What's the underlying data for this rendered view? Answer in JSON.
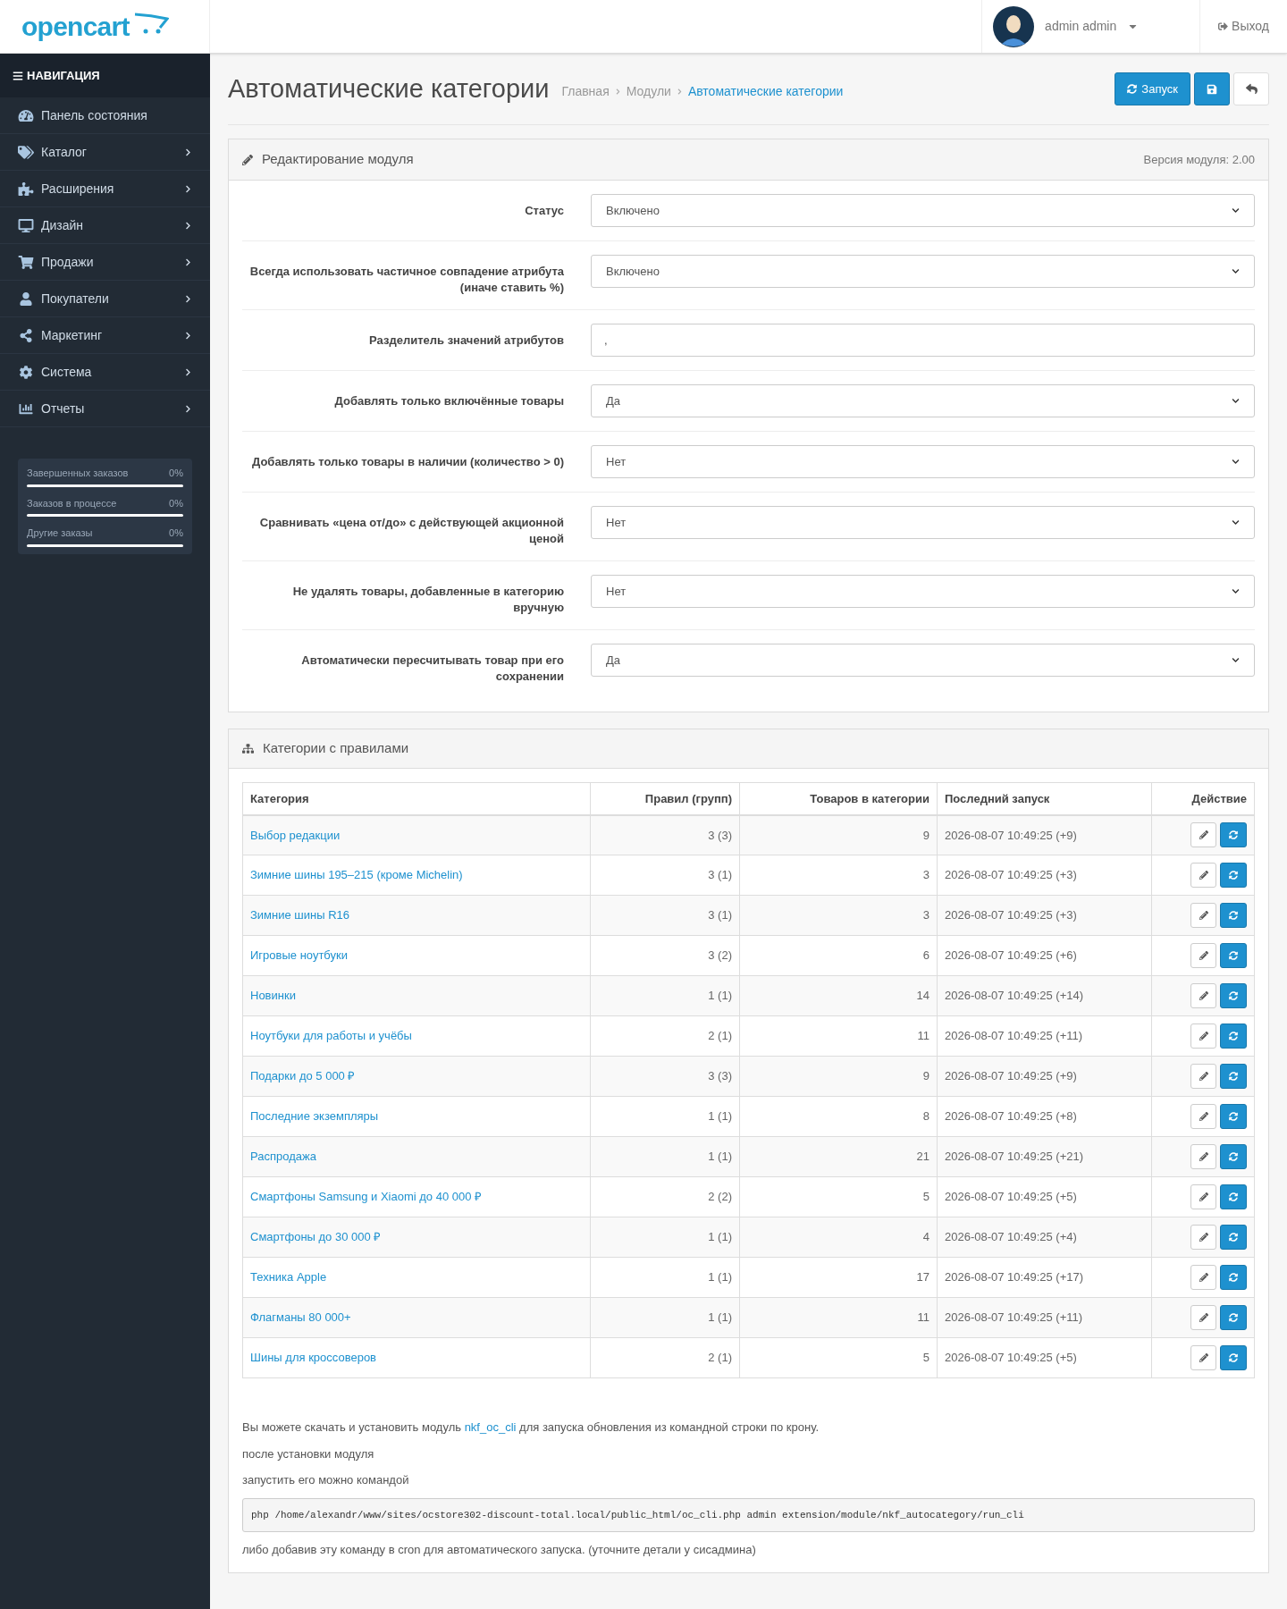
{
  "header": {
    "logo": "opencart",
    "user": "admin admin",
    "logout": "Выход"
  },
  "sidebar": {
    "title": "НАВИГАЦИЯ",
    "items": [
      {
        "label": "Панель состояния",
        "expandable": false
      },
      {
        "label": "Каталог",
        "expandable": true
      },
      {
        "label": "Расширения",
        "expandable": true
      },
      {
        "label": "Дизайн",
        "expandable": true
      },
      {
        "label": "Продажи",
        "expandable": true
      },
      {
        "label": "Покупатели",
        "expandable": true
      },
      {
        "label": "Маркетинг",
        "expandable": true
      },
      {
        "label": "Система",
        "expandable": true
      },
      {
        "label": "Отчеты",
        "expandable": true
      }
    ],
    "stats": [
      {
        "label": "Завершенных заказов",
        "reading": "0%",
        "level": 0
      },
      {
        "label": "Заказов в процессе",
        "reading": "0%",
        "level": 0
      },
      {
        "label": "Другие заказы",
        "reading": "0%",
        "level": 0
      }
    ]
  },
  "page": {
    "title": "Автоматические категории",
    "breadcrumbs": [
      {
        "label": "Главная",
        "selected": false
      },
      {
        "label": "Модули",
        "selected": false
      },
      {
        "label": "Автоматические категории",
        "selected": true
      }
    ],
    "run_button": "Запуск"
  },
  "edit_panel": {
    "title": "Редактирование модуля",
    "version": "Версия модуля: 2.00",
    "fields": [
      {
        "label": "Статус",
        "kind": "select",
        "value": "Включено"
      },
      {
        "label": "Всегда использовать частичное совпадение атрибута (иначе ставить %)",
        "kind": "select",
        "value": "Включено"
      },
      {
        "label": "Разделитель значений атрибутов",
        "kind": "text",
        "value": ","
      },
      {
        "label": "Добавлять только включённые товары",
        "kind": "select",
        "value": "Да"
      },
      {
        "label": "Добавлять только товары в наличии (количество > 0)",
        "kind": "select",
        "value": "Нет"
      },
      {
        "label": "Сравнивать «цена от/до» с действующей акционной ценой",
        "kind": "select",
        "value": "Нет"
      },
      {
        "label": "Не удалять товары, добавленные в категорию вручную",
        "kind": "select",
        "value": "Нет"
      },
      {
        "label": "Автоматически пересчитывать товар при его сохранении",
        "kind": "select",
        "value": "Да"
      }
    ]
  },
  "categories_panel": {
    "title": "Категории с правилами",
    "table": {
      "columns": [
        "Категория",
        "Правил (групп)",
        "Товаров в категории",
        "Последний запуск",
        "Действие"
      ],
      "rows": [
        {
          "category": "Выбор редакции",
          "rules": "3 (3)",
          "products": "9",
          "last_run": "2026-08-07 10:49:25 (+9)"
        },
        {
          "category": "Зимние шины 195–215 (кроме Michelin)",
          "rules": "3 (1)",
          "products": "3",
          "last_run": "2026-08-07 10:49:25 (+3)"
        },
        {
          "category": "Зимние шины R16",
          "rules": "3 (1)",
          "products": "3",
          "last_run": "2026-08-07 10:49:25 (+3)"
        },
        {
          "category": "Игровые ноутбуки",
          "rules": "3 (2)",
          "products": "6",
          "last_run": "2026-08-07 10:49:25 (+6)"
        },
        {
          "category": "Новинки",
          "rules": "1 (1)",
          "products": "14",
          "last_run": "2026-08-07 10:49:25 (+14)"
        },
        {
          "category": "Ноутбуки для работы и учёбы",
          "rules": "2 (1)",
          "products": "11",
          "last_run": "2026-08-07 10:49:25 (+11)"
        },
        {
          "category": "Подарки до 5 000 ₽",
          "rules": "3 (3)",
          "products": "9",
          "last_run": "2026-08-07 10:49:25 (+9)"
        },
        {
          "category": "Последние экземпляры",
          "rules": "1 (1)",
          "products": "8",
          "last_run": "2026-08-07 10:49:25 (+8)"
        },
        {
          "category": "Распродажа",
          "rules": "1 (1)",
          "products": "21",
          "last_run": "2026-08-07 10:49:25 (+21)"
        },
        {
          "category": "Смартфоны Samsung и Xiaomi до 40 000 ₽",
          "rules": "2 (2)",
          "products": "5",
          "last_run": "2026-08-07 10:49:25 (+5)"
        },
        {
          "category": "Смартфоны до 30 000 ₽",
          "rules": "1 (1)",
          "products": "4",
          "last_run": "2026-08-07 10:49:25 (+4)"
        },
        {
          "category": "Техника Apple",
          "rules": "1 (1)",
          "products": "17",
          "last_run": "2026-08-07 10:49:25 (+17)"
        },
        {
          "category": "Флагманы 80 000+",
          "rules": "1 (1)",
          "products": "11",
          "last_run": "2026-08-07 10:49:25 (+11)"
        },
        {
          "category": "Шины для кроссоверов",
          "rules": "2 (1)",
          "products": "5",
          "last_run": "2026-08-07 10:49:25 (+5)"
        }
      ]
    },
    "note": {
      "before": "Вы можете скачать и установить модуль",
      "link": "nkf_oc_cli",
      "after": "для запуска обновления из командной строки по крону."
    },
    "lines": [
      "после установки модуля",
      "запустить его можно командой"
    ],
    "command": "php /home/alexandr/www/sites/ocstore302-discount-total.local/public_html/oc_cli.php admin extension/module/nkf_autocategory/run_cli",
    "footer": "либо добавив эту команду в cron для автоматического запуска. (уточните детали у сисадмина)"
  }
}
